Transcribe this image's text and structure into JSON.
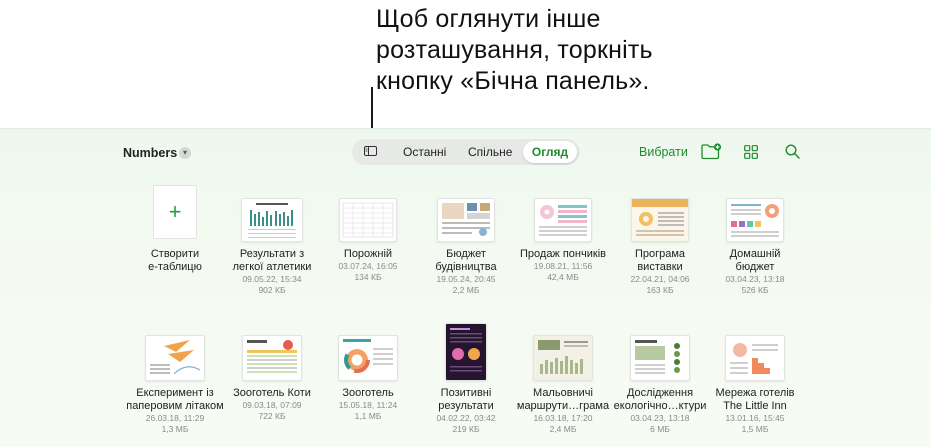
{
  "callout": {
    "lines": [
      "Щоб оглянути інше",
      "розташування, торкніть",
      "кнопку «Бічна панель»."
    ]
  },
  "header": {
    "app_title": "Numbers",
    "segments": {
      "recent": "Останні",
      "shared": "Спільне",
      "browse": "Огляд"
    },
    "select_label": "Вибрати"
  },
  "accent_color": "#1f8a2e",
  "documents": [
    {
      "name1": "Створити",
      "name2": "е-таблицю",
      "date": "",
      "size": ""
    },
    {
      "name1": "Результати з",
      "name2": "легкої атлетики",
      "date": "09.05.22, 15:34",
      "size": "902 КБ"
    },
    {
      "name1": "Порожній",
      "name2": "",
      "date": "03.07.24, 16:05",
      "size": "134 КБ"
    },
    {
      "name1": "Бюджет",
      "name2": "будівництва",
      "date": "19.05.24, 20:45",
      "size": "2,2 МБ"
    },
    {
      "name1": "Продаж пончиків",
      "name2": "",
      "date": "19.08.21, 11:56",
      "size": "42,4 МБ"
    },
    {
      "name1": "Програма",
      "name2": "виставки",
      "date": "22.04.21, 04:06",
      "size": "163 КБ"
    },
    {
      "name1": "Домашній",
      "name2": "бюджет",
      "date": "03.04.23, 13:18",
      "size": "526 КБ"
    },
    {
      "name1": "Експеримент із",
      "name2": "паперовим літаком",
      "date": "26.03.18, 11:29",
      "size": "1,3 МБ"
    },
    {
      "name1": "Зооготель Коти",
      "name2": "",
      "date": "09.03.18, 07:09",
      "size": "722 КБ"
    },
    {
      "name1": "Зооготель",
      "name2": "",
      "date": "15.05.18, 11:24",
      "size": "1,1 МБ"
    },
    {
      "name1": "Позитивні",
      "name2": "результати",
      "date": "04.02.22, 03:42",
      "size": "219 КБ"
    },
    {
      "name1": "Мальовничі",
      "name2": "маршрути…грама",
      "date": "16.03.18, 17:20",
      "size": "2,4 МБ"
    },
    {
      "name1": "Дослідження",
      "name2": "екологічно…ктури",
      "date": "03.04.23, 13:18",
      "size": "6 МБ"
    },
    {
      "name1": "Мережа готелів",
      "name2": "The Little Inn",
      "date": "13.01.16, 15:45",
      "size": "1,5 МБ"
    }
  ]
}
